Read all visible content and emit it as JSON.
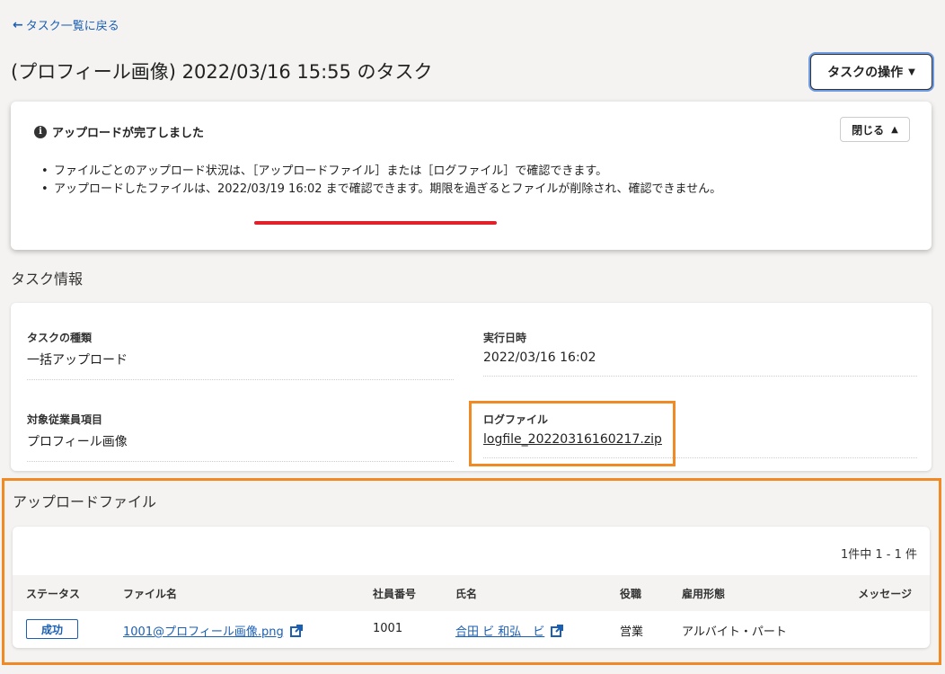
{
  "nav": {
    "back_label": "タスク一覧に戻る"
  },
  "page": {
    "title": "(プロフィール画像) 2022/03/16 15:55 のタスク"
  },
  "toolbar": {
    "ops_label": "タスクの操作"
  },
  "alert": {
    "heading": "アップロードが完了しました",
    "close_label": "閉じる",
    "items": [
      "ファイルごとのアップロード状況は、［アップロードファイル］または［ログファイル］で確認できます。",
      "アップロードしたファイルは、2022/03/19 16:02 まで確認できます。期限を過ぎるとファイルが削除され、確認できません。"
    ]
  },
  "task_info": {
    "section_title": "タスク情報",
    "fields": [
      {
        "label": "タスクの種類",
        "value": "一括アップロード"
      },
      {
        "label": "実行日時",
        "value": "2022/03/16 16:02"
      },
      {
        "label": "対象従業員項目",
        "value": "プロフィール画像"
      },
      {
        "label": "ログファイル",
        "value": "logfile_20220316160217.zip"
      }
    ]
  },
  "upload": {
    "section_title": "アップロードファイル",
    "count": "1件中 1 - 1 件",
    "columns": [
      "ステータス",
      "ファイル名",
      "社員番号",
      "氏名",
      "役職",
      "雇用形態",
      "メッセージ"
    ],
    "rows": [
      {
        "status": "成功",
        "file": "1001@プロフィール画像.png",
        "emp_no": "1001",
        "name": "合田 ビ 和弘　ビ",
        "title": "営業",
        "employment": "アルバイト・パート",
        "message": ""
      }
    ]
  },
  "colors": {
    "accent": "#1a5fb4",
    "annotation_orange": "#f08a24",
    "annotation_red": "#e2202a",
    "background": "#f4f3f1"
  }
}
